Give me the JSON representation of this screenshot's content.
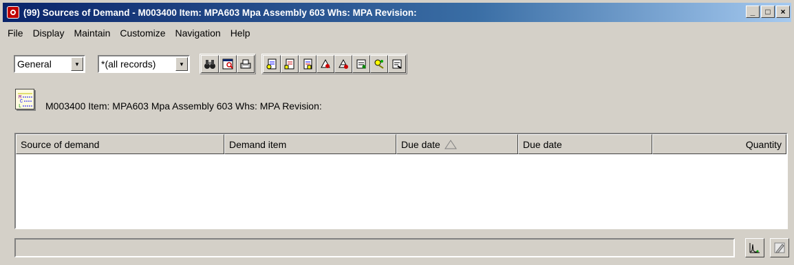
{
  "window": {
    "title": "(99) Sources of Demand - M003400  Item: MPA603  Mpa Assembly 603  Whs: MPA  Revision:",
    "minimize": "_",
    "maximize": "□",
    "close": "×"
  },
  "menu": [
    "File",
    "Display",
    "Maintain",
    "Customize",
    "Navigation",
    "Help"
  ],
  "toolbar": {
    "view_combo": "General",
    "filter_combo": "*(all records)",
    "icons": [
      "binoculars-icon",
      "report-preview-icon",
      "print-icon",
      "form1-icon",
      "form2-icon",
      "form3-icon",
      "tool1-icon",
      "tool2-icon",
      "tool3-icon",
      "tool4-icon",
      "tool5-icon"
    ]
  },
  "info": {
    "text": "M003400  Item: MPA603  Mpa Assembly 603  Whs: MPA  Revision:"
  },
  "table": {
    "columns": [
      "Source of demand",
      "Demand item",
      "Due date",
      "Due date",
      "Quantity"
    ],
    "rows": []
  },
  "colors": {
    "title_start": "#0a246a",
    "title_end": "#a6caf0",
    "face": "#d4d0c8"
  }
}
